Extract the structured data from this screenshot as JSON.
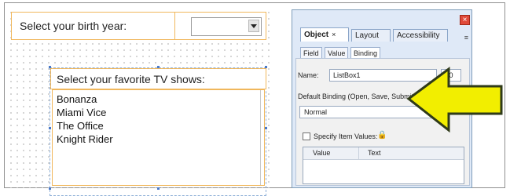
{
  "form": {
    "birth_year_label": "Select your birth year:",
    "tv_label": "Select your favorite TV shows:",
    "tv_items": [
      "Bonanza",
      "Miami Vice",
      "The Office",
      "Knight Rider"
    ]
  },
  "panel": {
    "close_glyph": "×",
    "tabs": [
      "Object",
      "Layout",
      "Accessibility"
    ],
    "object_tab_close": "×",
    "menu_glyph": "≡",
    "subtabs": [
      "Field",
      "Value",
      "Binding"
    ],
    "name_label": "Name:",
    "name_value": "ListBox1",
    "index_value": "0",
    "default_binding_label": "Default Binding (Open, Save, Submit):",
    "default_binding_value": "Normal",
    "list_glyph": "☰",
    "specify_items_label": "Specify Item Values:",
    "lock_glyph": "🔒",
    "grid_headers": [
      "Value",
      "Text"
    ]
  },
  "colors": {
    "field_border": "#f0b75c",
    "panel_bg": "#dfe9f7",
    "arrow_fill": "#f2ee00",
    "arrow_stroke": "#2f3a18"
  }
}
